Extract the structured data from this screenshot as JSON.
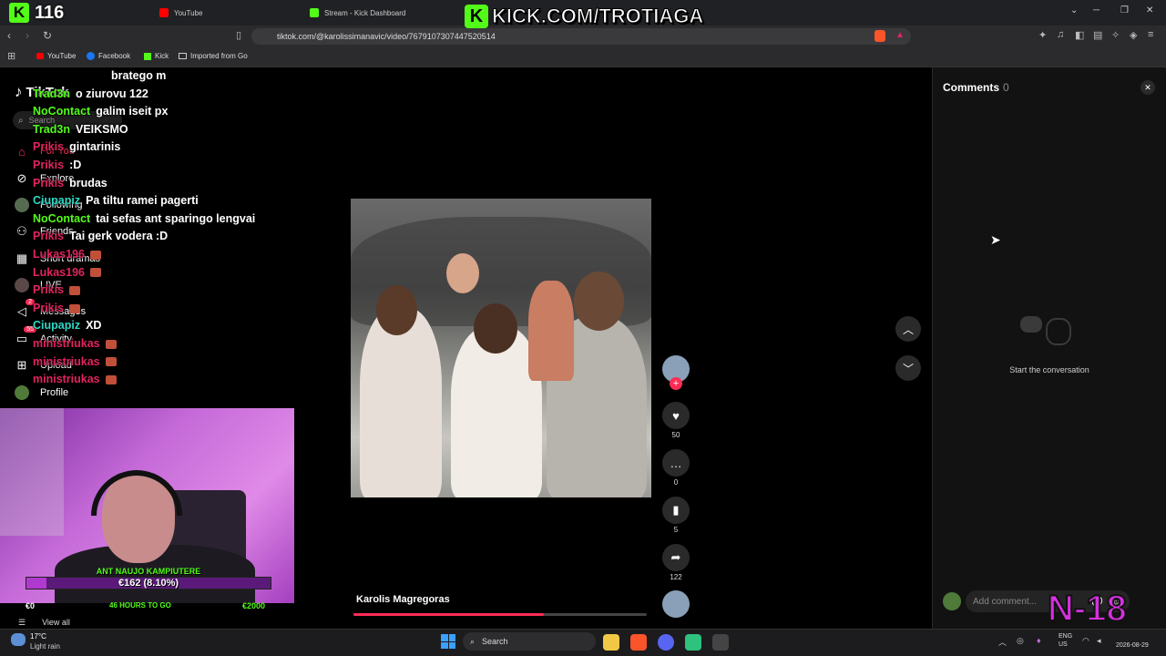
{
  "browser": {
    "tabs": [
      {
        "label": "YouTube",
        "color": "#ff0000"
      },
      {
        "label": "Stream - Kick Dashboard",
        "color": "#53fc18"
      }
    ],
    "url": "tiktok.com/@karolissimanavic/video/7679107307447520514",
    "bookmarks": [
      {
        "label": "YouTube",
        "icon": "youtube-icon"
      },
      {
        "label": "Facebook",
        "icon": "facebook-icon"
      },
      {
        "label": "Kick",
        "icon": "kick-icon"
      },
      {
        "label": "Imported from Go",
        "icon": "folder-icon"
      }
    ]
  },
  "overlay": {
    "kick_count": "116",
    "kick_banner": "KICK.COM/TROTIAGA",
    "n18": "N-18"
  },
  "tiktok": {
    "logo": "TikTok",
    "search_placeholder": "Search",
    "sidebar": [
      {
        "label": "For You",
        "icon": "home-icon",
        "active": true
      },
      {
        "label": "Explore",
        "icon": "compass-icon"
      },
      {
        "label": "Following",
        "icon": "following-avatar-icon"
      },
      {
        "label": "Friends",
        "icon": "friends-icon"
      },
      {
        "label": "Short dramas",
        "icon": "film-icon"
      },
      {
        "label": "LIVE",
        "icon": "live-icon"
      },
      {
        "label": "Messages",
        "icon": "messages-icon",
        "badge": "2"
      },
      {
        "label": "Activity",
        "icon": "activity-icon",
        "badge": "55"
      },
      {
        "label": "Upload",
        "icon": "upload-icon"
      },
      {
        "label": "Profile",
        "icon": "profile-avatar-icon"
      }
    ],
    "video_author": "Karolis Magregoras",
    "actions": {
      "likes": "50",
      "comments": "0",
      "saves": "5",
      "shares": "122"
    },
    "comments_panel": {
      "title": "Comments",
      "count": "0",
      "empty_text": "Start the conversation",
      "input_placeholder": "Add comment..."
    },
    "view_all": "View all"
  },
  "chat": [
    {
      "user": "",
      "msg": "bratego m",
      "color": "#53fc18"
    },
    {
      "user": "Trad3n",
      "msg": "o ziurovu 122",
      "color": "#53fc18"
    },
    {
      "user": "NoContact",
      "msg": "galim iseit px",
      "color": "#53fc18"
    },
    {
      "user": "Trad3n",
      "msg": "VEIKSMO",
      "color": "#53fc18"
    },
    {
      "user": "Prikis",
      "msg": "gintarinis",
      "color": "#e0245e"
    },
    {
      "user": "Prikis",
      "msg": ":D",
      "color": "#e0245e"
    },
    {
      "user": "Prikis",
      "msg": "brudas",
      "color": "#e0245e"
    },
    {
      "user": "Ciupapiz",
      "msg": "Pa tiltu ramei pagerti",
      "color": "#2fd7c4"
    },
    {
      "user": "NoContact",
      "msg": "tai sefas ant sparingo lengvai",
      "color": "#53fc18"
    },
    {
      "user": "Prikis",
      "msg": "Tai gerk vodera :D",
      "color": "#e0245e"
    },
    {
      "user": "Lukas196",
      "msg": "",
      "color": "#e0245e"
    },
    {
      "user": "Lukas196",
      "msg": "",
      "color": "#e0245e"
    },
    {
      "user": "Prikis",
      "msg": "",
      "color": "#e0245e"
    },
    {
      "user": "Prikis",
      "msg": "",
      "color": "#e0245e"
    },
    {
      "user": "Ciupapiz",
      "msg": "XD",
      "color": "#2fd7c4"
    },
    {
      "user": "ministriukas",
      "msg": "",
      "color": "#e0245e"
    },
    {
      "user": "ministriukas",
      "msg": "",
      "color": "#e0245e"
    },
    {
      "user": "ministriukas",
      "msg": "",
      "color": "#e0245e"
    }
  ],
  "goal": {
    "title": "ANT NAUJO KAMPIUTERE",
    "amount": "€162 (8.10%)",
    "start": "€0",
    "remaining": "46 HOURS TO GO",
    "target": "€2000",
    "progress": 0.081
  },
  "taskbar": {
    "weather_temp": "17°C",
    "weather_desc": "Light rain",
    "search": "Search",
    "lang": "ENG US",
    "date": "2026-08-29"
  }
}
